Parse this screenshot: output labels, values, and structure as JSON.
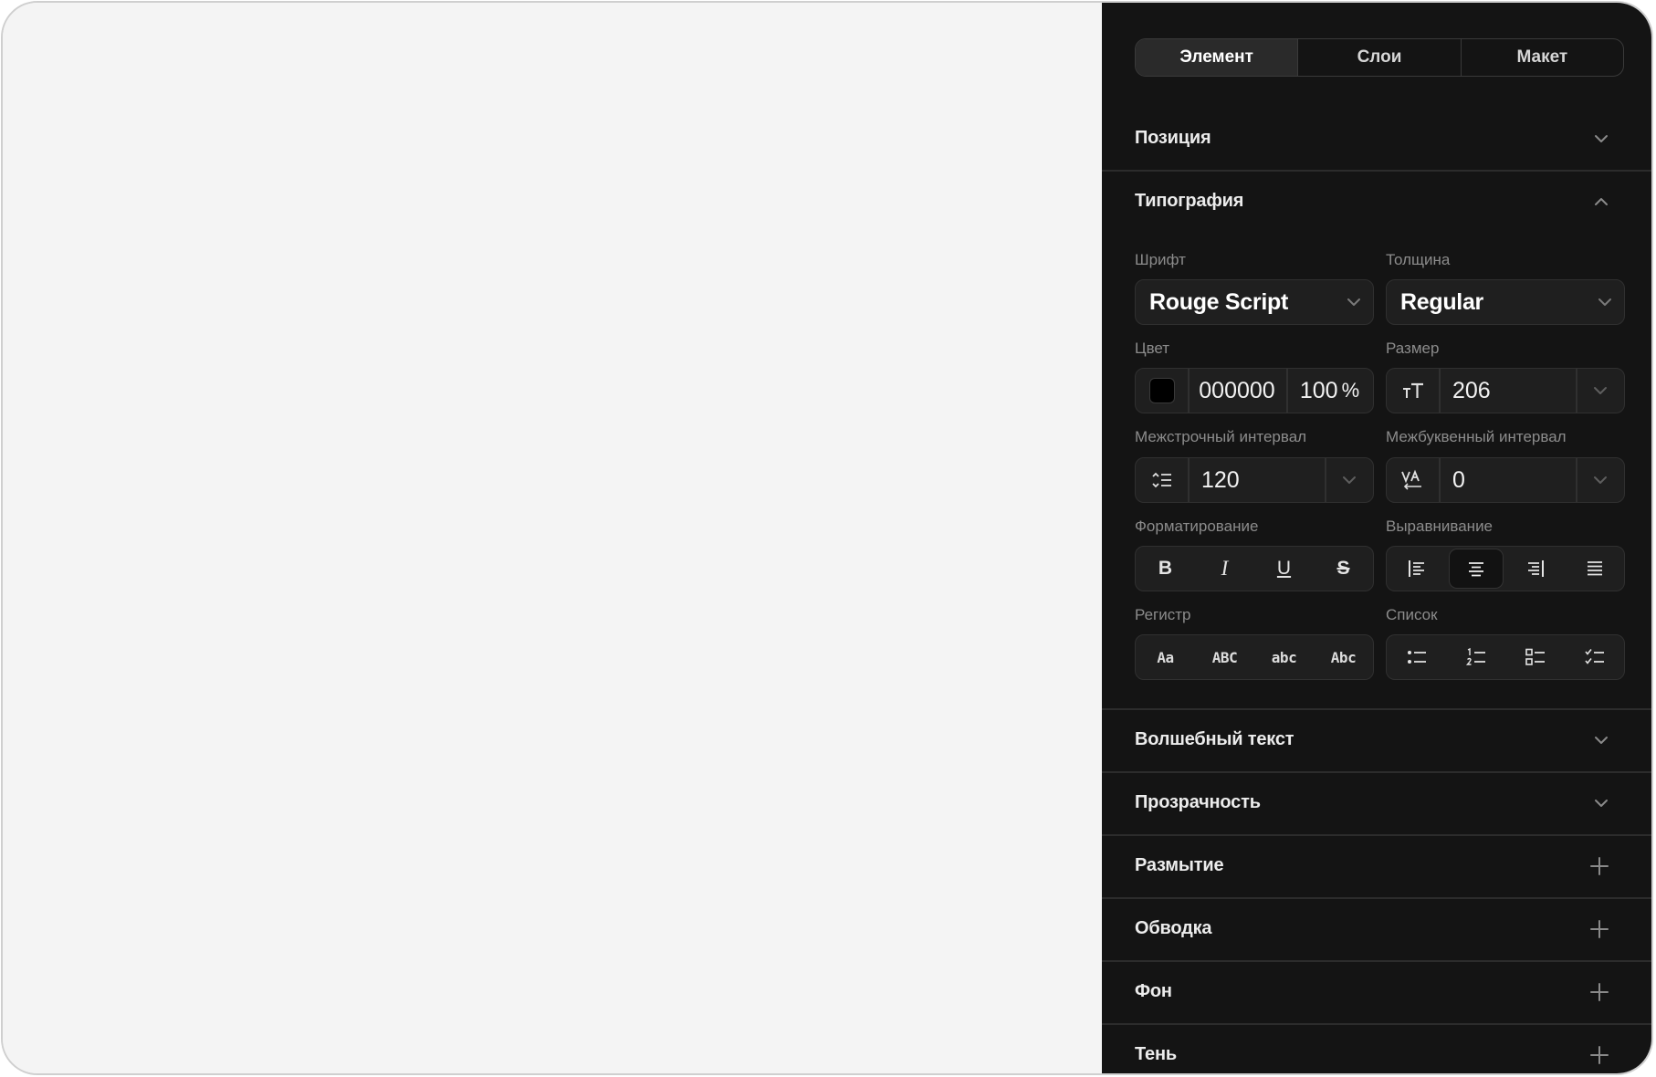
{
  "tabs": [
    "Элемент",
    "Слои",
    "Макет"
  ],
  "sections": {
    "position": "Позиция",
    "typography": "Типография",
    "magic_text": "Волшебный текст",
    "transparency": "Прозрачность",
    "blur": "Размытие",
    "stroke": "Обводка",
    "background": "Фон",
    "shadow": "Тень"
  },
  "typography": {
    "font_label": "Шрифт",
    "font_value": "Rouge Script",
    "weight_label": "Толщина",
    "weight_value": "Regular",
    "color_label": "Цвет",
    "color_hex": "000000",
    "color_opacity": "100",
    "percent": "%",
    "swatch_color": "#000000",
    "size_label": "Размер",
    "size_value": "206",
    "line_height_label": "Межстрочный интервал",
    "line_height_value": "120",
    "letter_spacing_label": "Межбуквенный интервал",
    "letter_spacing_value": "0",
    "formatting_label": "Форматирование",
    "formatting": [
      "B",
      "I",
      "U",
      "S"
    ],
    "alignment_label": "Выравнивание",
    "alignment_active": "center",
    "case_label": "Регистр",
    "case_options": [
      "Aa",
      "ABC",
      "abc",
      "Abc"
    ],
    "list_label": "Список"
  },
  "colors": {
    "panel_bg": "#141414",
    "canvas_bg": "#f4f4f4",
    "field_bg": "#1f1f1f"
  }
}
